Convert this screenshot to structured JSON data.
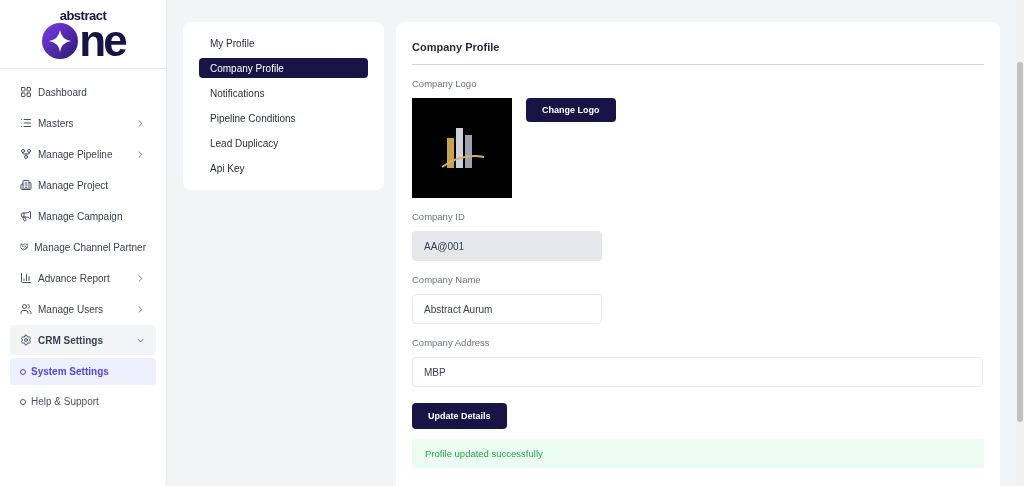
{
  "logo": {
    "top": "abstract",
    "main": "ne"
  },
  "sidebar": {
    "items": [
      {
        "label": "Dashboard",
        "has_submenu": false
      },
      {
        "label": "Masters",
        "has_submenu": true
      },
      {
        "label": "Manage Pipeline",
        "has_submenu": true
      },
      {
        "label": "Manage Project",
        "has_submenu": false
      },
      {
        "label": "Manage Campaign",
        "has_submenu": false
      },
      {
        "label": "Manage Channel Partner",
        "has_submenu": false
      },
      {
        "label": "Advance Report",
        "has_submenu": true
      },
      {
        "label": "Manage Users",
        "has_submenu": true
      },
      {
        "label": "CRM Settings",
        "has_submenu": true,
        "expanded": true,
        "children": [
          {
            "label": "System Settings",
            "selected": true
          },
          {
            "label": "Help & Support",
            "selected": false
          }
        ]
      }
    ]
  },
  "settings_menu": [
    {
      "label": "My Profile",
      "selected": false
    },
    {
      "label": "Company Profile",
      "selected": true
    },
    {
      "label": "Notifications",
      "selected": false
    },
    {
      "label": "Pipeline Conditions",
      "selected": false
    },
    {
      "label": "Lead Duplicacy",
      "selected": false
    },
    {
      "label": "Api Key",
      "selected": false
    }
  ],
  "profile": {
    "title": "Company Profile",
    "logo_label": "Company Logo",
    "change_logo": "Change Logo",
    "fields": [
      {
        "label": "Company ID",
        "value": "AA@001",
        "disabled": true,
        "wide": false
      },
      {
        "label": "Company Name",
        "value": "Abstract Aurum",
        "disabled": false,
        "wide": false
      },
      {
        "label": "Company Address",
        "value": "MBP",
        "disabled": false,
        "wide": true
      }
    ],
    "submit": "Update Details",
    "message": "Profile updated successfully"
  }
}
